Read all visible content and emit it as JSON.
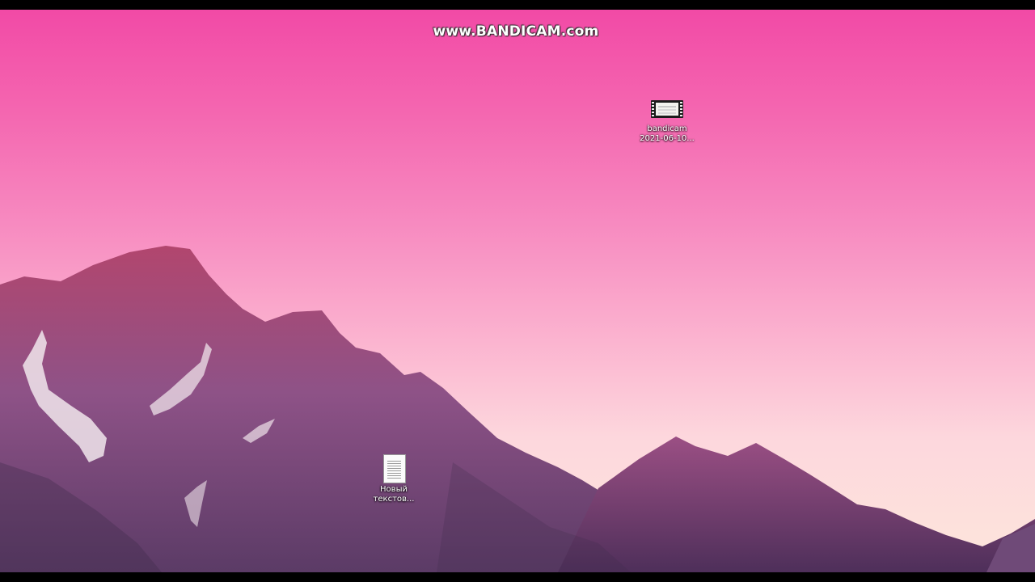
{
  "watermark": {
    "text": "www.BANDICAM.com"
  },
  "desktop": {
    "icons": [
      {
        "name": "bandicam-video",
        "type": "video-file-icon",
        "label_line1": "bandicam",
        "label_line2": "2021-06-10..."
      },
      {
        "name": "new-text-document",
        "type": "text-document-icon",
        "label_line1": "Новый",
        "label_line2": "текстов..."
      }
    ]
  },
  "colors": {
    "sky_top": "#f24aa6",
    "sky_bottom": "#fde6dc",
    "mountain": "#8a4a86"
  }
}
